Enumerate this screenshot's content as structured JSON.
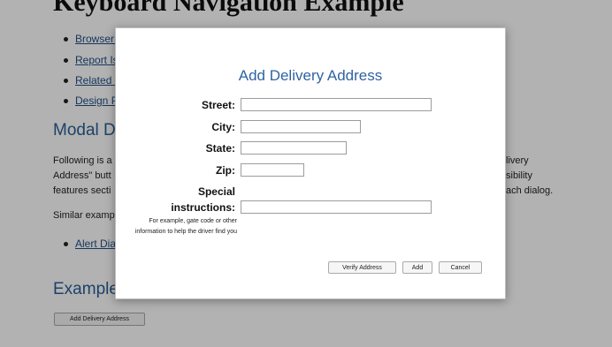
{
  "page": {
    "title": "Keyboard Navigation Example",
    "nav_links": [
      "Browser Support",
      "Report Issue",
      "Related Issues",
      "Design Pattern"
    ],
    "modal_heading": "Modal Dialog",
    "para_lines_left": [
      "Following is a",
      "Address\" butt",
      "features secti"
    ],
    "para_lines_right": [
      "livery",
      "sibility",
      "ach dialog."
    ],
    "similar_text": "Similar examp",
    "similar_link": "Alert Dia",
    "example_heading": "Example",
    "add_button_label": "Add Delivery Address"
  },
  "dialog": {
    "title": "Add Delivery Address",
    "fields": {
      "street_label": "Street:",
      "city_label": "City:",
      "state_label": "State:",
      "zip_label": "Zip:",
      "special_label_1": "Special",
      "special_label_2": "instructions:"
    },
    "help_text": "For example, gate code or other information to help the driver find you",
    "buttons": {
      "verify": "Verify Address",
      "add": "Add",
      "cancel": "Cancel"
    }
  },
  "colors": {
    "link": "#1f4f86",
    "heading": "#2a5d95",
    "dialog_title": "#2f63a3",
    "backdrop": "rgba(0,0,0,0.30)"
  }
}
